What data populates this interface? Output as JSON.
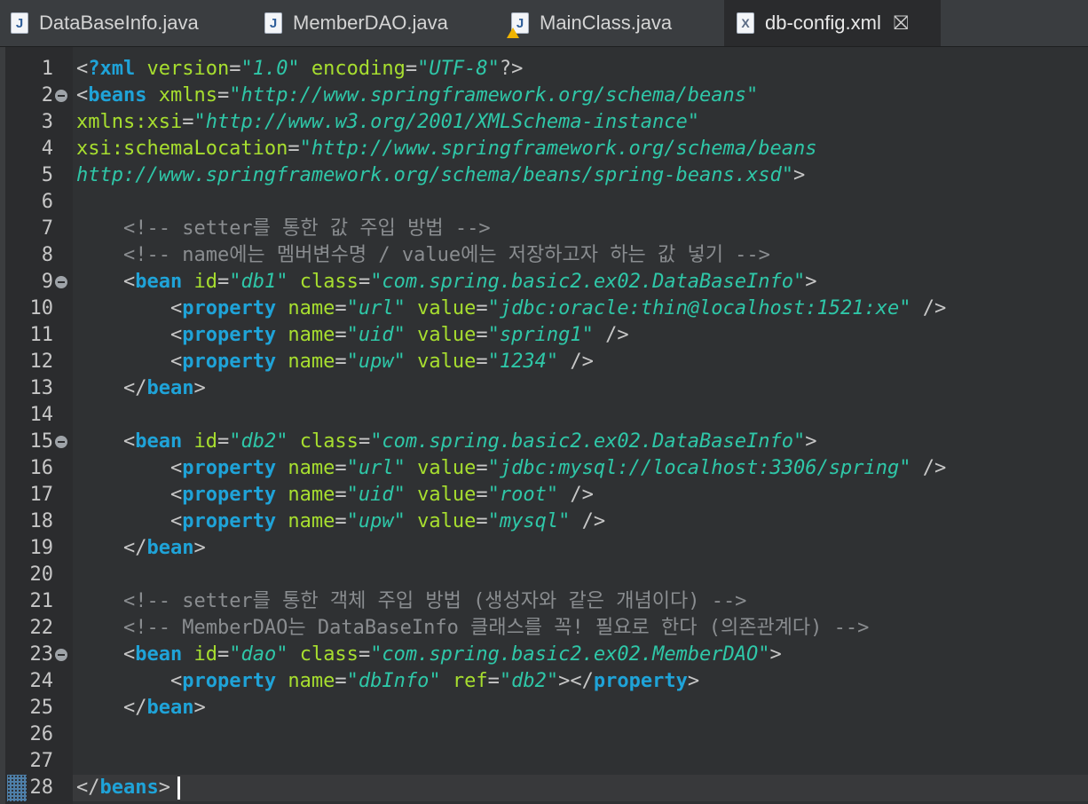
{
  "tabs": [
    {
      "label": "DataBaseInfo.java",
      "icon": "J",
      "icon_name": "java-file-icon"
    },
    {
      "label": "MemberDAO.java",
      "icon": "J",
      "icon_name": "java-file-icon"
    },
    {
      "label": "MainClass.java",
      "icon": "J",
      "icon_name": "java-file-warning-icon"
    },
    {
      "label": "db-config.xml",
      "icon": "X",
      "icon_name": "xml-file-icon",
      "close": "⛝"
    }
  ],
  "colors": {
    "punct": "#c7c7c7",
    "tag": "#1fa3d8",
    "attr": "#a7de2f",
    "str": "#2fc7a8",
    "comment": "#8a8d90",
    "text": "#d4d4d4"
  },
  "editor": {
    "lines": [
      {
        "n": "1",
        "fold": false,
        "tokens": [
          [
            "punct",
            "<"
          ],
          [
            "tag",
            "?xml"
          ],
          [
            "attr",
            " version"
          ],
          [
            "punct",
            "="
          ],
          [
            "str",
            "\"1.0\""
          ],
          [
            "attr",
            " encoding"
          ],
          [
            "punct",
            "="
          ],
          [
            "str",
            "\"UTF-8\""
          ],
          [
            "punct",
            "?>"
          ]
        ]
      },
      {
        "n": "2",
        "fold": true,
        "tokens": [
          [
            "punct",
            "<"
          ],
          [
            "tag",
            "beans"
          ],
          [
            "attr",
            " xmlns"
          ],
          [
            "punct",
            "="
          ],
          [
            "str",
            "\"http://www.springframework.org/schema/beans\""
          ]
        ]
      },
      {
        "n": "3",
        "fold": false,
        "tokens": [
          [
            "attr",
            "xmlns:xsi"
          ],
          [
            "punct",
            "="
          ],
          [
            "str",
            "\"http://www.w3.org/2001/XMLSchema-instance\""
          ]
        ]
      },
      {
        "n": "4",
        "fold": false,
        "tokens": [
          [
            "attr",
            "xsi:schemaLocation"
          ],
          [
            "punct",
            "="
          ],
          [
            "str",
            "\"http://www.springframework.org/schema/beans"
          ]
        ]
      },
      {
        "n": "5",
        "fold": false,
        "tokens": [
          [
            "str",
            "http://www.springframework.org/schema/beans/spring-beans.xsd\""
          ],
          [
            "punct",
            ">"
          ]
        ]
      },
      {
        "n": "6",
        "fold": false,
        "tokens": []
      },
      {
        "n": "7",
        "fold": false,
        "tokens": [
          [
            "text",
            "    "
          ],
          [
            "comment",
            "<!-- setter를 통한 값 주입 방법 -->"
          ]
        ]
      },
      {
        "n": "8",
        "fold": false,
        "tokens": [
          [
            "text",
            "    "
          ],
          [
            "comment",
            "<!-- name에는 멤버변수명 / value에는 저장하고자 하는 값 넣기 -->"
          ]
        ]
      },
      {
        "n": "9",
        "fold": true,
        "tokens": [
          [
            "text",
            "    "
          ],
          [
            "punct",
            "<"
          ],
          [
            "tag",
            "bean"
          ],
          [
            "attr",
            " id"
          ],
          [
            "punct",
            "="
          ],
          [
            "str",
            "\"db1\""
          ],
          [
            "attr",
            " class"
          ],
          [
            "punct",
            "="
          ],
          [
            "str",
            "\"com.spring.basic2.ex02.DataBaseInfo\""
          ],
          [
            "punct",
            ">"
          ]
        ]
      },
      {
        "n": "10",
        "fold": false,
        "tokens": [
          [
            "text",
            "        "
          ],
          [
            "punct",
            "<"
          ],
          [
            "tag",
            "property"
          ],
          [
            "attr",
            " name"
          ],
          [
            "punct",
            "="
          ],
          [
            "str",
            "\"url\""
          ],
          [
            "attr",
            " value"
          ],
          [
            "punct",
            "="
          ],
          [
            "str",
            "\"jdbc:oracle:thin@localhost:1521:xe\""
          ],
          [
            "punct",
            " />"
          ]
        ]
      },
      {
        "n": "11",
        "fold": false,
        "tokens": [
          [
            "text",
            "        "
          ],
          [
            "punct",
            "<"
          ],
          [
            "tag",
            "property"
          ],
          [
            "attr",
            " name"
          ],
          [
            "punct",
            "="
          ],
          [
            "str",
            "\"uid\""
          ],
          [
            "attr",
            " value"
          ],
          [
            "punct",
            "="
          ],
          [
            "str",
            "\"spring1\""
          ],
          [
            "punct",
            " />"
          ]
        ]
      },
      {
        "n": "12",
        "fold": false,
        "tokens": [
          [
            "text",
            "        "
          ],
          [
            "punct",
            "<"
          ],
          [
            "tag",
            "property"
          ],
          [
            "attr",
            " name"
          ],
          [
            "punct",
            "="
          ],
          [
            "str",
            "\"upw\""
          ],
          [
            "attr",
            " value"
          ],
          [
            "punct",
            "="
          ],
          [
            "str",
            "\"1234\""
          ],
          [
            "punct",
            " />"
          ]
        ]
      },
      {
        "n": "13",
        "fold": false,
        "tokens": [
          [
            "text",
            "    "
          ],
          [
            "punct",
            "</"
          ],
          [
            "tag",
            "bean"
          ],
          [
            "punct",
            ">"
          ]
        ]
      },
      {
        "n": "14",
        "fold": false,
        "tokens": []
      },
      {
        "n": "15",
        "fold": true,
        "tokens": [
          [
            "text",
            "    "
          ],
          [
            "punct",
            "<"
          ],
          [
            "tag",
            "bean"
          ],
          [
            "attr",
            " id"
          ],
          [
            "punct",
            "="
          ],
          [
            "str",
            "\"db2\""
          ],
          [
            "attr",
            " class"
          ],
          [
            "punct",
            "="
          ],
          [
            "str",
            "\"com.spring.basic2.ex02.DataBaseInfo\""
          ],
          [
            "punct",
            ">"
          ]
        ]
      },
      {
        "n": "16",
        "fold": false,
        "tokens": [
          [
            "text",
            "        "
          ],
          [
            "punct",
            "<"
          ],
          [
            "tag",
            "property"
          ],
          [
            "attr",
            " name"
          ],
          [
            "punct",
            "="
          ],
          [
            "str",
            "\"url\""
          ],
          [
            "attr",
            " value"
          ],
          [
            "punct",
            "="
          ],
          [
            "str",
            "\"jdbc:mysql://localhost:3306/spring\""
          ],
          [
            "punct",
            " />"
          ]
        ]
      },
      {
        "n": "17",
        "fold": false,
        "tokens": [
          [
            "text",
            "        "
          ],
          [
            "punct",
            "<"
          ],
          [
            "tag",
            "property"
          ],
          [
            "attr",
            " name"
          ],
          [
            "punct",
            "="
          ],
          [
            "str",
            "\"uid\""
          ],
          [
            "attr",
            " value"
          ],
          [
            "punct",
            "="
          ],
          [
            "str",
            "\"root\""
          ],
          [
            "punct",
            " />"
          ]
        ]
      },
      {
        "n": "18",
        "fold": false,
        "tokens": [
          [
            "text",
            "        "
          ],
          [
            "punct",
            "<"
          ],
          [
            "tag",
            "property"
          ],
          [
            "attr",
            " name"
          ],
          [
            "punct",
            "="
          ],
          [
            "str",
            "\"upw\""
          ],
          [
            "attr",
            " value"
          ],
          [
            "punct",
            "="
          ],
          [
            "str",
            "\"mysql\""
          ],
          [
            "punct",
            " />"
          ]
        ]
      },
      {
        "n": "19",
        "fold": false,
        "tokens": [
          [
            "text",
            "    "
          ],
          [
            "punct",
            "</"
          ],
          [
            "tag",
            "bean"
          ],
          [
            "punct",
            ">"
          ]
        ]
      },
      {
        "n": "20",
        "fold": false,
        "tokens": []
      },
      {
        "n": "21",
        "fold": false,
        "tokens": [
          [
            "text",
            "    "
          ],
          [
            "comment",
            "<!-- setter를 통한 객체 주입 방법 (생성자와 같은 개념이다) -->"
          ]
        ]
      },
      {
        "n": "22",
        "fold": false,
        "tokens": [
          [
            "text",
            "    "
          ],
          [
            "comment",
            "<!-- MemberDAO는 DataBaseInfo 클래스를 꼭! 필요로 한다 (의존관계다) -->"
          ]
        ]
      },
      {
        "n": "23",
        "fold": true,
        "tokens": [
          [
            "text",
            "    "
          ],
          [
            "punct",
            "<"
          ],
          [
            "tag",
            "bean"
          ],
          [
            "attr",
            " id"
          ],
          [
            "punct",
            "="
          ],
          [
            "str",
            "\"dao\""
          ],
          [
            "attr",
            " class"
          ],
          [
            "punct",
            "="
          ],
          [
            "str",
            "\"com.spring.basic2.ex02.MemberDAO\""
          ],
          [
            "punct",
            ">"
          ]
        ]
      },
      {
        "n": "24",
        "fold": false,
        "tokens": [
          [
            "text",
            "        "
          ],
          [
            "punct",
            "<"
          ],
          [
            "tag",
            "property"
          ],
          [
            "attr",
            " name"
          ],
          [
            "punct",
            "="
          ],
          [
            "str",
            "\"dbInfo\""
          ],
          [
            "attr",
            " ref"
          ],
          [
            "punct",
            "="
          ],
          [
            "str",
            "\"db2\""
          ],
          [
            "punct",
            "></"
          ],
          [
            "tag",
            "property"
          ],
          [
            "punct",
            ">"
          ]
        ]
      },
      {
        "n": "25",
        "fold": false,
        "tokens": [
          [
            "text",
            "    "
          ],
          [
            "punct",
            "</"
          ],
          [
            "tag",
            "bean"
          ],
          [
            "punct",
            ">"
          ]
        ]
      },
      {
        "n": "26",
        "fold": false,
        "tokens": []
      },
      {
        "n": "27",
        "fold": false,
        "tokens": []
      },
      {
        "n": "28",
        "fold": false,
        "tokens": [
          [
            "punct",
            "</"
          ],
          [
            "tag",
            "beans"
          ],
          [
            "punct",
            ">"
          ]
        ]
      }
    ]
  }
}
